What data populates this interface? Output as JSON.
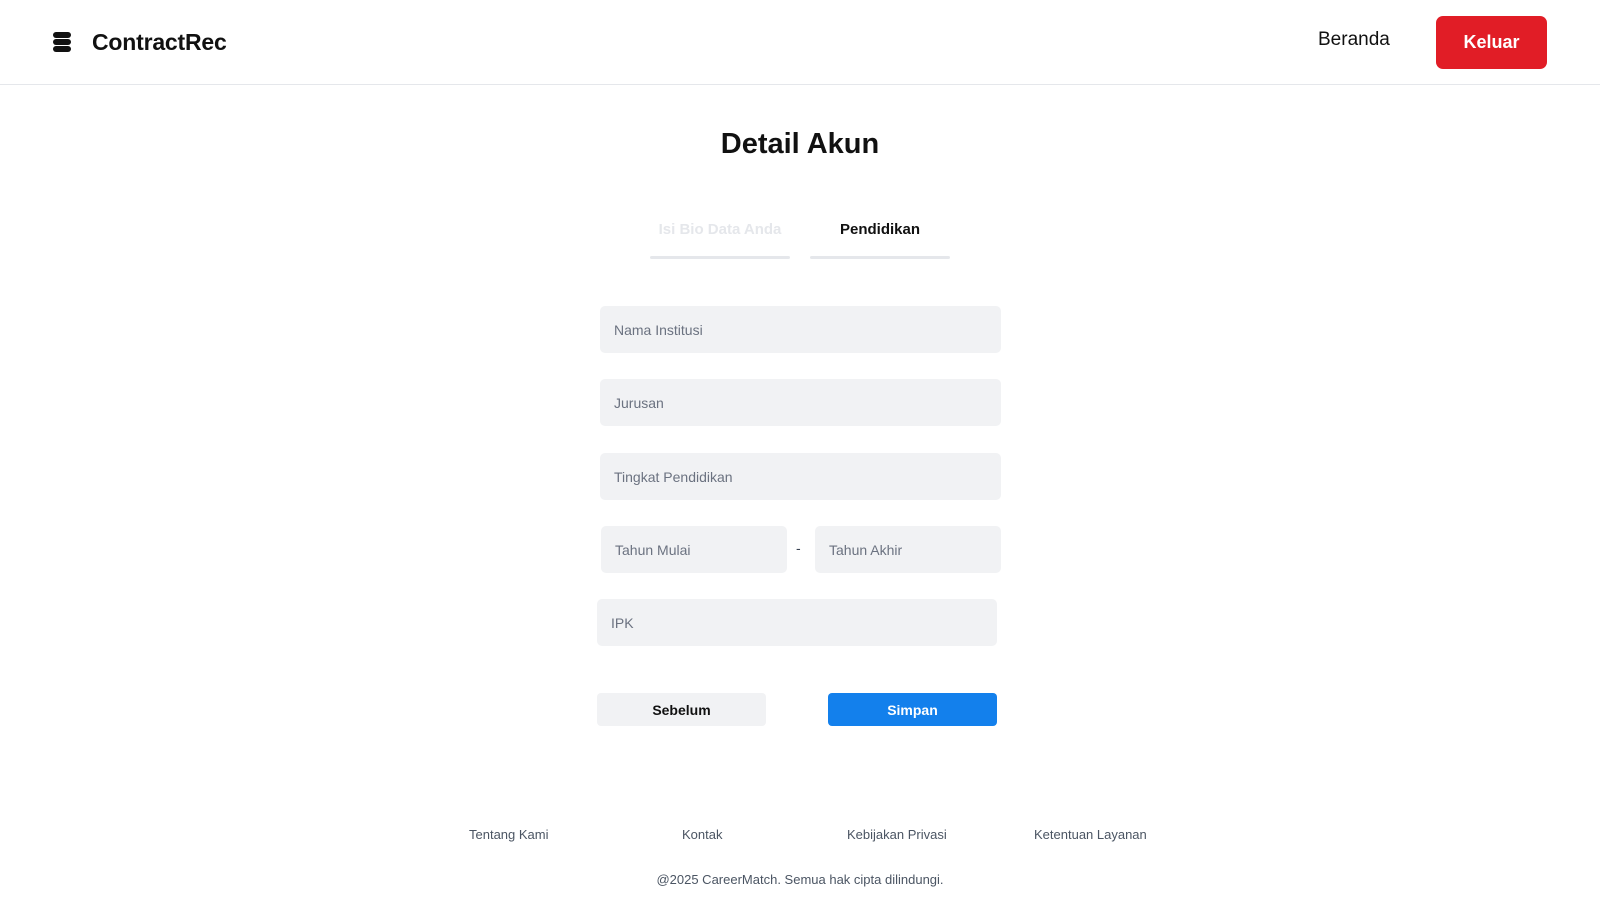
{
  "header": {
    "brand_name": "ContractRec",
    "brand_icon": "stack-icon",
    "nav_home_label": "Beranda",
    "logout_label": "Keluar",
    "logout_color": "#e11d26"
  },
  "main": {
    "title": "Detail Akun",
    "tabs": [
      {
        "label": "Isi Bio Data Anda",
        "active": false
      },
      {
        "label": "Pendidikan",
        "active": true
      }
    ],
    "fields": {
      "institution_placeholder": "Nama Institusi",
      "major_placeholder": "Jurusan",
      "level_placeholder": "Tingkat Pendidikan",
      "start_year_placeholder": "Tahun Mulai",
      "separator": "-",
      "end_year_placeholder": "Tahun Akhir",
      "gpa_placeholder": "IPK"
    },
    "buttons": {
      "prev_label": "Sebelum",
      "save_label": "Simpan",
      "save_color": "#1380ec"
    }
  },
  "footer": {
    "links": [
      "Tentang Kami",
      "Kontak",
      "Kebijakan Privasi",
      "Ketentuan Layanan"
    ],
    "copyright": "@2025 CareerMatch. Semua hak cipta dilindungi."
  }
}
